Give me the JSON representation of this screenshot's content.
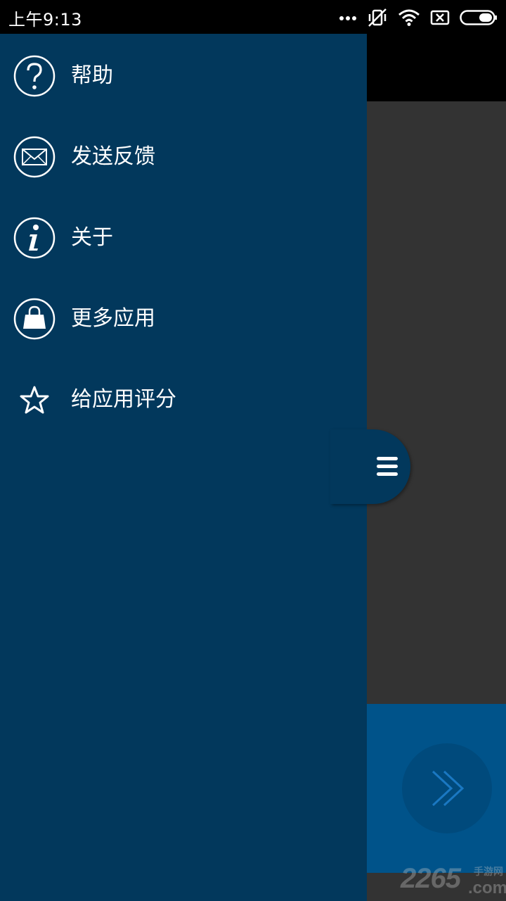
{
  "status_bar": {
    "time": "上午9:13",
    "icons": [
      "more-dots-icon",
      "vibrate-off-icon",
      "wifi-icon",
      "no-sim-icon",
      "battery-icon"
    ]
  },
  "drawer": {
    "items": [
      {
        "icon": "help-icon",
        "label": "帮助"
      },
      {
        "icon": "mail-icon",
        "label": "发送反馈"
      },
      {
        "icon": "info-icon",
        "label": "关于"
      },
      {
        "icon": "shopping-bag-icon",
        "label": "更多应用"
      },
      {
        "icon": "star-icon",
        "label": "给应用评分"
      }
    ],
    "handle_icon": "hamburger-menu-icon"
  },
  "background_app": {
    "next_icon": "double-chevron-right-icon"
  },
  "watermark": {
    "number": "2265",
    "domain": ".com",
    "subtitle": "手游网"
  },
  "colors": {
    "drawer_bg": "#02385c",
    "accent_blue": "#00538a",
    "content_bg": "#333333"
  }
}
